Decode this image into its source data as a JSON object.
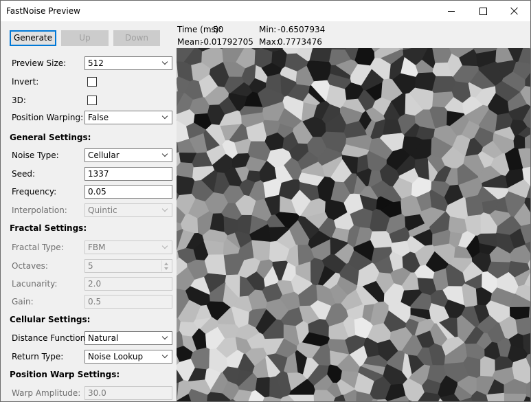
{
  "window": {
    "title": "FastNoise Preview"
  },
  "toolbar": {
    "generate": "Generate",
    "up": "Up",
    "down": "Down"
  },
  "stats": {
    "time_label": "Time (ms):",
    "time_value": "50",
    "min_label": "Min:",
    "min_value": "-0.6507934",
    "mean_label": "Mean:",
    "mean_value": "-0.01792705",
    "max_label": "Max:",
    "max_value": "0.7773476"
  },
  "preview_settings": {
    "size_label": "Preview Size:",
    "size_value": "512",
    "invert_label": "Invert:",
    "invert_checked": false,
    "threed_label": "3D:",
    "threed_checked": false,
    "warping_label": "Position Warping:",
    "warping_value": "False"
  },
  "general": {
    "heading": "General Settings:",
    "noise_type_label": "Noise Type:",
    "noise_type_value": "Cellular",
    "seed_label": "Seed:",
    "seed_value": "1337",
    "frequency_label": "Frequency:",
    "frequency_value": "0.05",
    "interpolation_label": "Interpolation:",
    "interpolation_value": "Quintic"
  },
  "fractal": {
    "heading": "Fractal Settings:",
    "type_label": "Fractal Type:",
    "type_value": "FBM",
    "octaves_label": "Octaves:",
    "octaves_value": "5",
    "lacunarity_label": "Lacunarity:",
    "lacunarity_value": "2.0",
    "gain_label": "Gain:",
    "gain_value": "0.5"
  },
  "cellular": {
    "heading": "Cellular Settings:",
    "distance_label": "Distance Function:",
    "distance_value": "Natural",
    "return_label": "Return Type:",
    "return_value": "Noise Lookup"
  },
  "warp": {
    "heading": "Position Warp Settings:",
    "amplitude_label": "Warp Amplitude:",
    "amplitude_value": "30.0"
  }
}
